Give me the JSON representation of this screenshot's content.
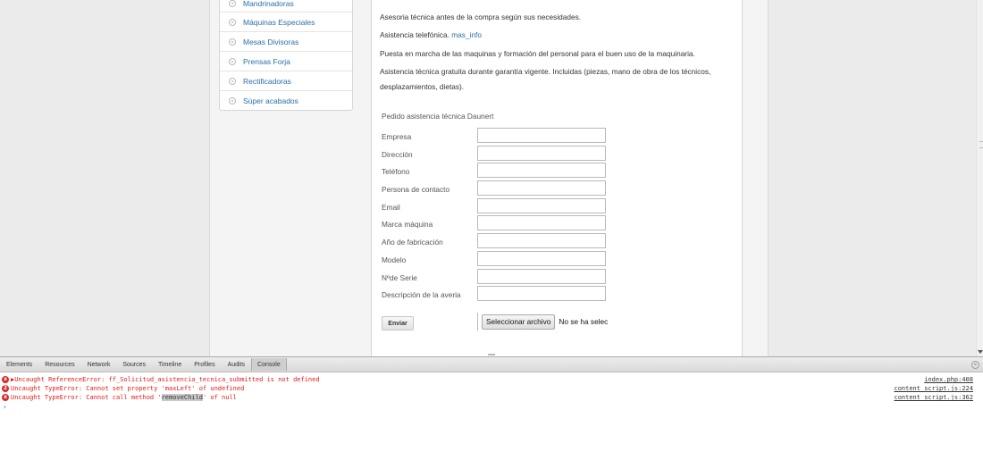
{
  "sidebar": {
    "items": [
      {
        "label": "Mandrinadoras"
      },
      {
        "label": "Máquinas Especiales"
      },
      {
        "label": "Mesas Divisoras"
      },
      {
        "label": "Prensas Forja"
      },
      {
        "label": "Rectificadoras"
      },
      {
        "label": "Súper acabados"
      }
    ]
  },
  "main": {
    "paragraphs": {
      "p1": "Asesoria técnica antes de la compra según sus necesidades.",
      "p2_text": "Asistencia telefónica.",
      "p2_link": "mas_info",
      "p3": "Puesta en marcha de las maquinas y formación del personal para el buen uso de la maquinaria.",
      "p4": "Asistencia técnica gratuita durante garantía vigente. Incluidas (piezas, mano de obra de los técnicos, desplazamientos, dietas)."
    },
    "form": {
      "title": "Pedido asistencia técnica Daunert",
      "fields": [
        {
          "label": "Empresa",
          "value": ""
        },
        {
          "label": "Dirección",
          "value": ""
        },
        {
          "label": "Teléfono",
          "value": ""
        },
        {
          "label": "Persona de contacto",
          "value": ""
        },
        {
          "label": "Email",
          "value": ""
        },
        {
          "label": "Marca máquina",
          "value": ""
        },
        {
          "label": "Año de fabricación",
          "value": ""
        },
        {
          "label": "Modelo",
          "value": ""
        },
        {
          "label": "Nºde Serie",
          "value": ""
        },
        {
          "label": "Descripción de la averia",
          "value": ""
        }
      ],
      "submit_label": "Enviar",
      "file_button_label": "Seleccionar archivo",
      "file_status": "No se ha selec"
    }
  },
  "devtools": {
    "tabs": [
      "Elements",
      "Resources",
      "Network",
      "Sources",
      "Timeline",
      "Profiles",
      "Audits",
      "Console"
    ],
    "active_tab": "Console",
    "console": [
      {
        "icon": "x",
        "pre": "▶Uncaught ReferenceError: ff_Solicitud_asistencia_tecnica_submitted is not defined",
        "highlight": "",
        "post": "",
        "source": "index.php:408"
      },
      {
        "icon": "2",
        "pre": "Uncaught TypeError: Cannot set property 'maxLeft' of undefined",
        "highlight": "",
        "post": "",
        "source": "content_script.js:224"
      },
      {
        "icon": "x",
        "pre": "Uncaught TypeError: Cannot call method '",
        "highlight": "removeChild",
        "post": "' of null",
        "source": "content_script.js:362"
      }
    ],
    "prompt": "›"
  },
  "colors": {
    "link": "#2a6fa8",
    "error": "#e01b1b",
    "prompt": "#2a6fd6"
  }
}
